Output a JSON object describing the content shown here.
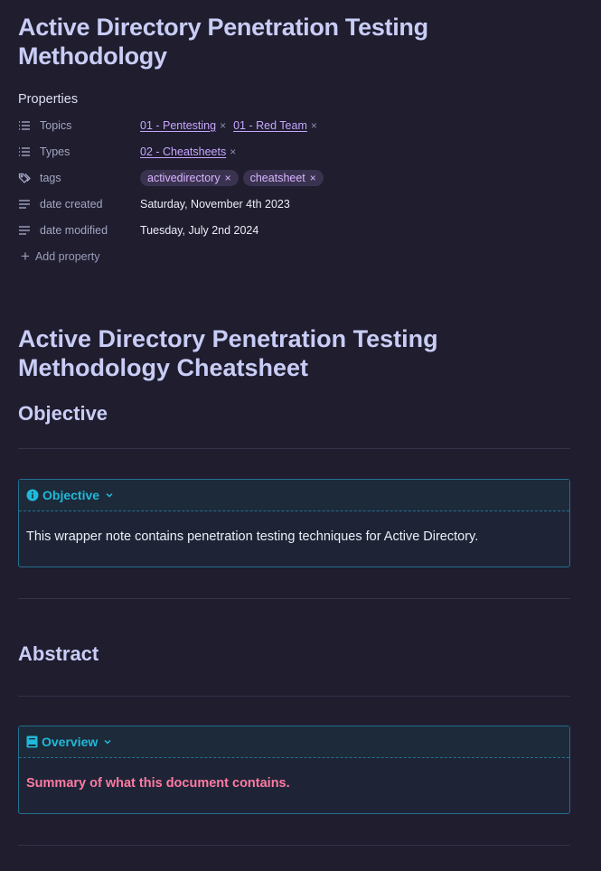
{
  "note": {
    "title": "Active Directory Penetration Testing Methodology"
  },
  "properties": {
    "heading": "Properties",
    "rows": {
      "topics": {
        "key": "Topics",
        "values": [
          "01 - Pentesting",
          "01 - Red Team"
        ]
      },
      "types": {
        "key": "Types",
        "values": [
          "02 - Cheatsheets"
        ]
      },
      "tags": {
        "key": "tags",
        "values": [
          "activedirectory",
          "cheatsheet"
        ]
      },
      "date_created": {
        "key": "date created",
        "value": "Saturday, November 4th 2023"
      },
      "date_modified": {
        "key": "date modified",
        "value": "Tuesday, July 2nd 2024"
      }
    },
    "add_label": "Add property",
    "remove_glyph": "×"
  },
  "content": {
    "h1": "Active Directory Penetration Testing Methodology Cheatsheet",
    "objective_heading": "Objective",
    "objective_callout": {
      "title": "Objective",
      "body": "This wrapper note contains penetration testing techniques for Active Directory."
    },
    "abstract_heading": "Abstract",
    "overview_callout": {
      "title": "Overview",
      "body": "Summary of what this document contains."
    }
  },
  "colors": {
    "background": "#1f1d2e",
    "heading": "#c9cdf6",
    "link": "#c6a6ff",
    "callout_accent": "#20b9d9",
    "overview_text": "#ff7aa2"
  }
}
